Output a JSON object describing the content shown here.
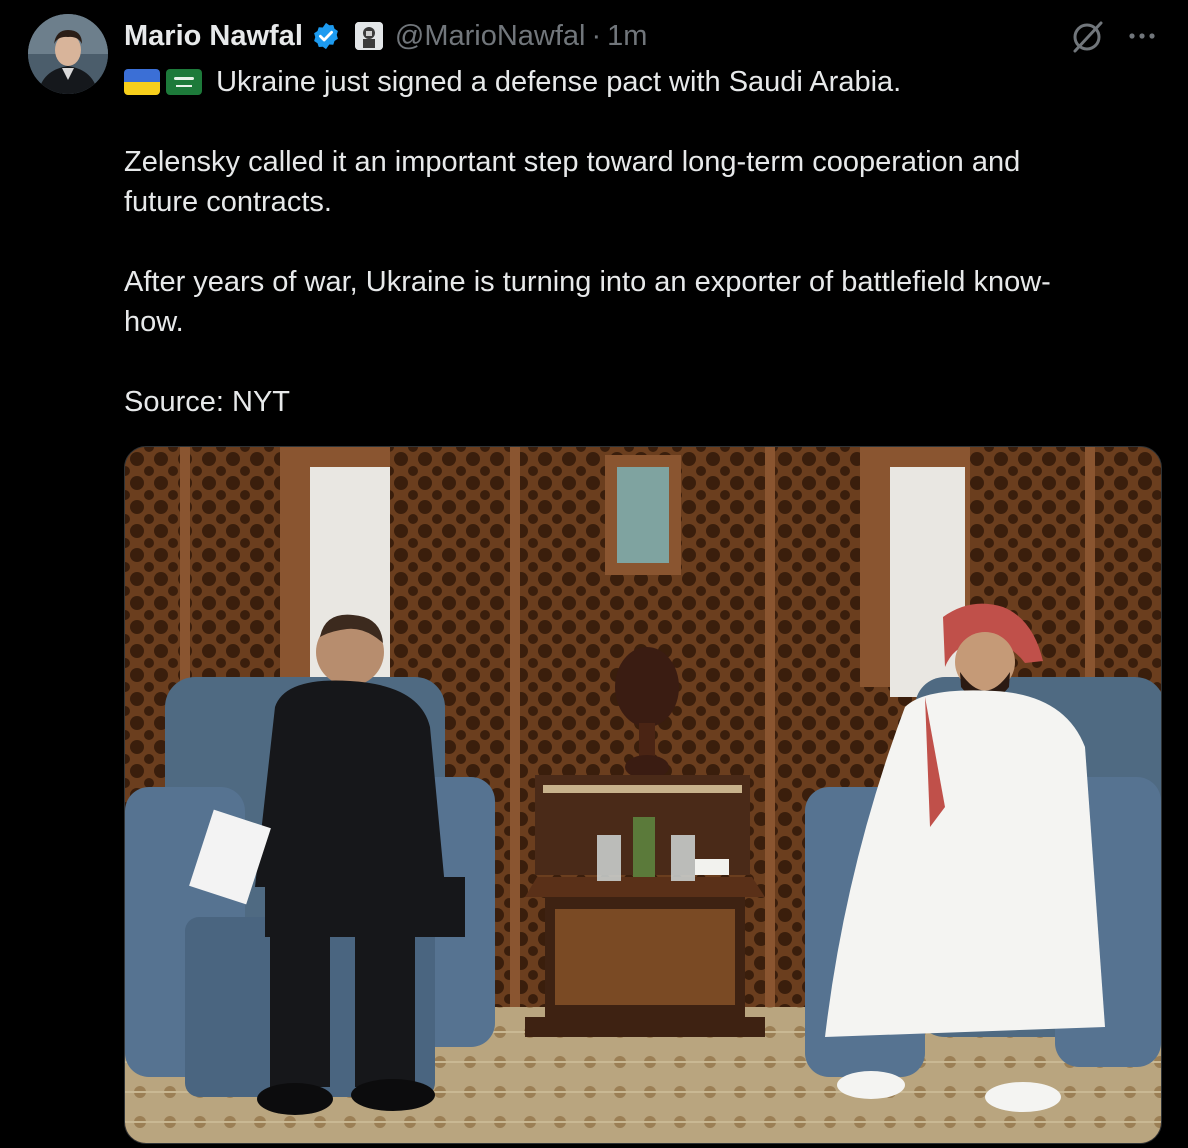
{
  "author": {
    "name": "Mario Nawfal",
    "handle": "@MarioNawfal",
    "separator": "·",
    "time": "1m"
  },
  "icons": {
    "verified": "verified-badge-icon",
    "affiliate": "affiliate-badge-icon",
    "grok": "grok-icon",
    "more": "more-options-icon"
  },
  "colors": {
    "background": "#000000",
    "text": "#e7e9ea",
    "muted": "#71767b",
    "verified_blue": "#1d9bf0"
  },
  "tweet": {
    "flags": [
      "ukraine-flag",
      "saudi-flag"
    ],
    "line1": "Ukraine just signed a defense pact with Saudi Arabia.",
    "line2a": "Zelensky called it an important step toward long-term cooperation and",
    "line2b": "future contracts.",
    "line3a": "After years of war, Ukraine is turning into an exporter of battlefield know-",
    "line3b": "how.",
    "line4": "Source: NYT"
  }
}
